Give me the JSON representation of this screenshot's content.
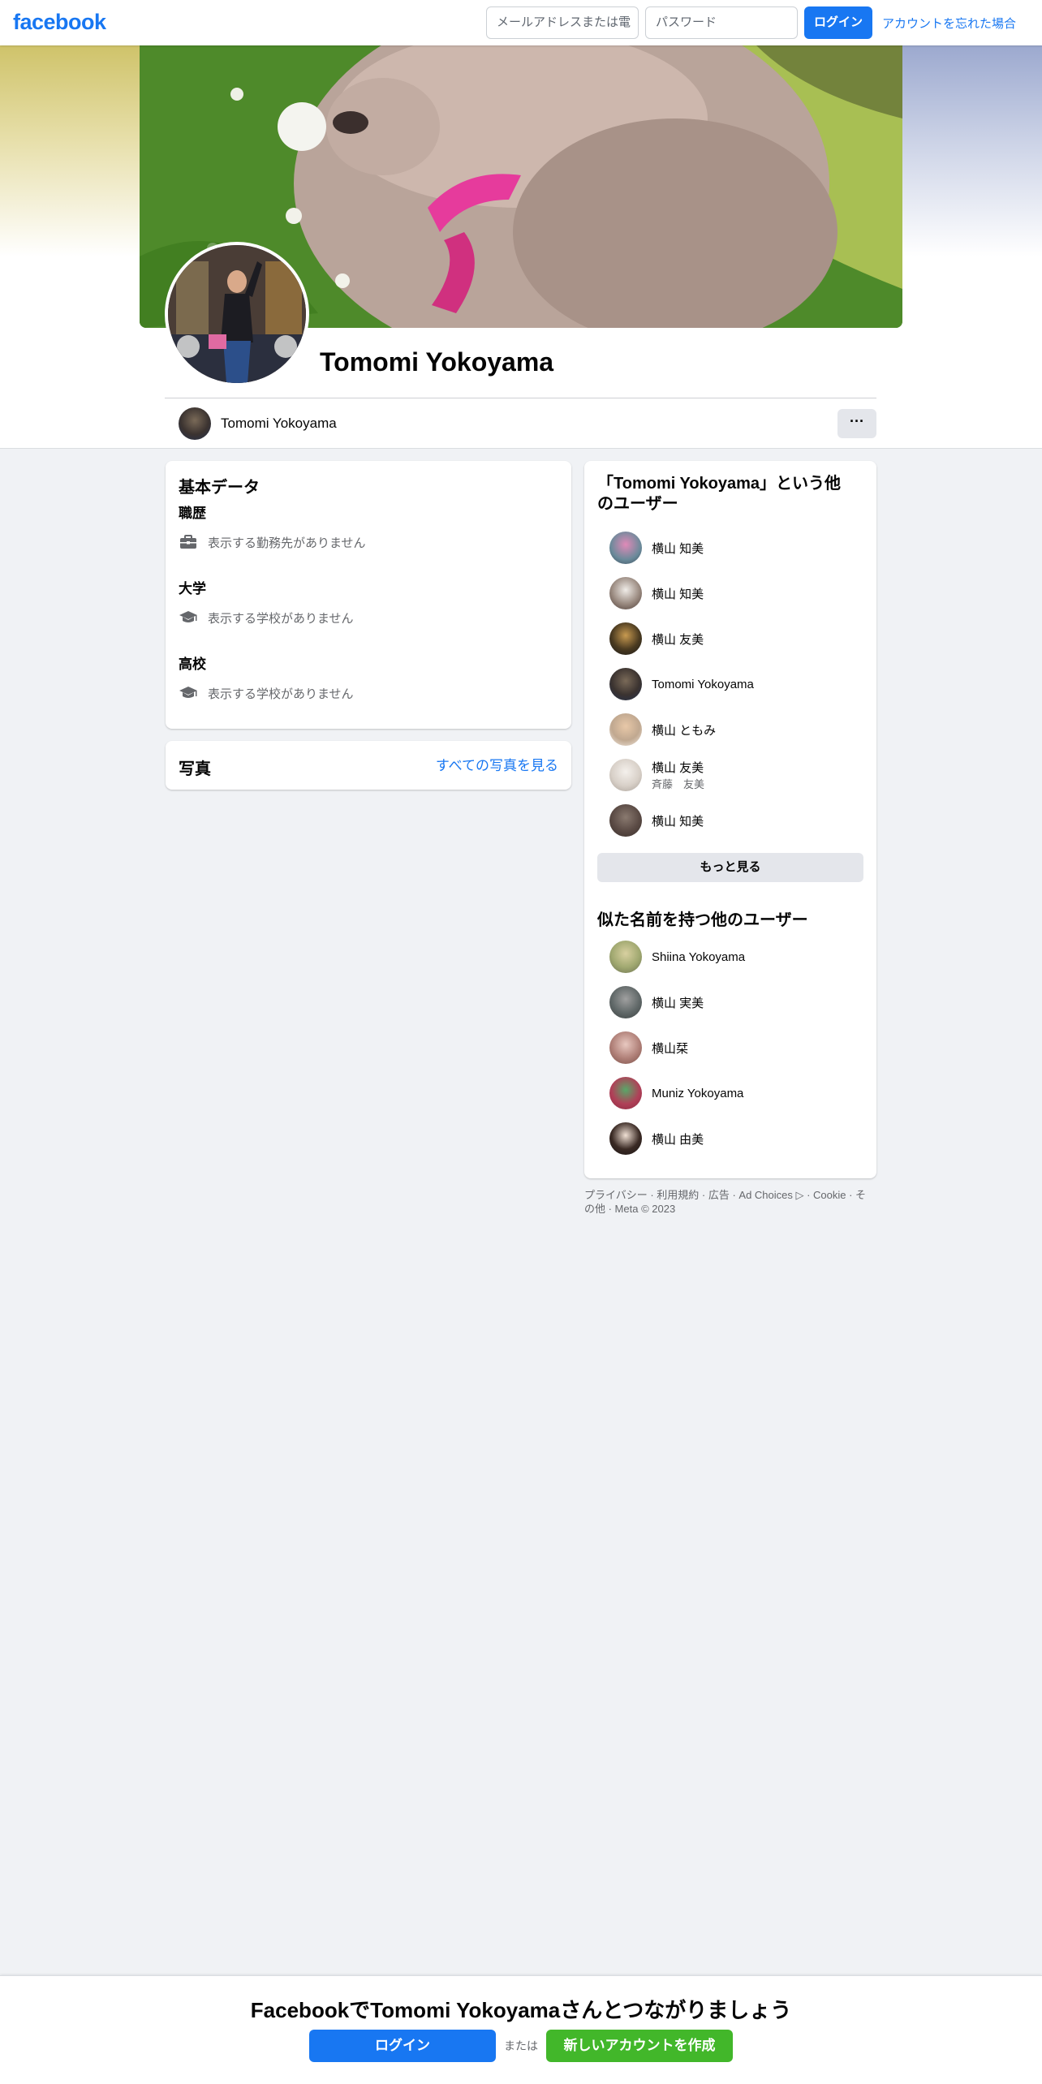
{
  "topbar": {
    "logo": "facebook",
    "email_placeholder": "メールアドレスまたは電",
    "password_placeholder": "パスワード",
    "login_label": "ログイン",
    "forgot_label": "アカウントを忘れた場合"
  },
  "profile": {
    "name": "Tomomi Yokoyama",
    "more_label": "···"
  },
  "about": {
    "title": "基本データ",
    "sections": [
      {
        "heading": "職歴",
        "text": "表示する勤務先がありません",
        "icon": "briefcase-icon"
      },
      {
        "heading": "大学",
        "text": "表示する学校がありません",
        "icon": "graduation-cap-icon"
      },
      {
        "heading": "高校",
        "text": "表示する学校がありません",
        "icon": "graduation-cap-icon"
      }
    ]
  },
  "photos": {
    "title": "写真",
    "see_all": "すべての写真を見る"
  },
  "others_same_name": {
    "title": "「Tomomi Yokoyama」という他のユーザー",
    "people": [
      {
        "name": "横山 知美",
        "sub": ""
      },
      {
        "name": "横山 知美",
        "sub": ""
      },
      {
        "name": "横山 友美",
        "sub": ""
      },
      {
        "name": "Tomomi Yokoyama",
        "sub": ""
      },
      {
        "name": "横山 ともみ",
        "sub": ""
      },
      {
        "name": "横山 友美",
        "sub": "斉藤　友美"
      },
      {
        "name": "横山 知美",
        "sub": ""
      }
    ],
    "see_more": "もっと見る"
  },
  "similar_names": {
    "title": "似た名前を持つ他のユーザー",
    "people": [
      {
        "name": "Shiina Yokoyama"
      },
      {
        "name": "横山 実美"
      },
      {
        "name": "横山栞"
      },
      {
        "name": "Muniz Yokoyama"
      },
      {
        "name": "横山 由美"
      }
    ]
  },
  "footer": {
    "line1": "プライバシー · 利用規約 · 広告 · Ad Choices ▷ · Cookie · そ",
    "line2": "の他 · Meta © 2023"
  },
  "banner": {
    "text": "FacebookでTomomi Yokoyamaさんとつながりましょう",
    "login_label": "ログイン",
    "or_label": "または",
    "create_label": "新しいアカウントを作成"
  },
  "colors": {
    "brand": "#1877f2",
    "create_green": "#42b72a",
    "page_bg": "#f0f2f5"
  }
}
